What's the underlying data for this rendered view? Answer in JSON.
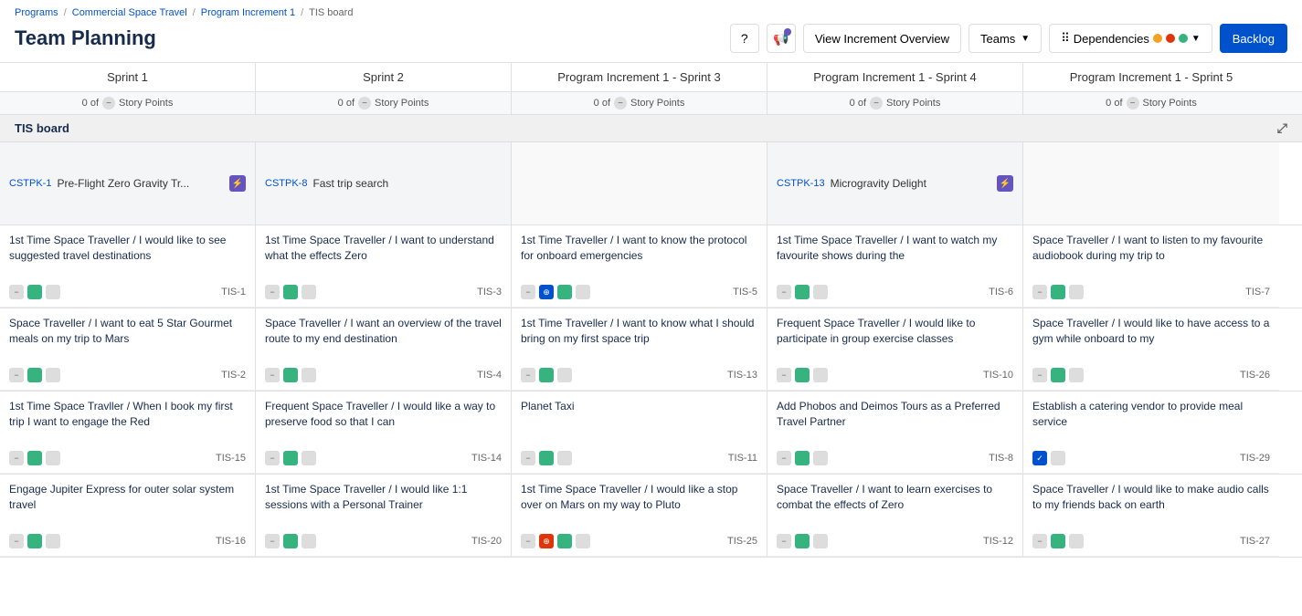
{
  "breadcrumb": {
    "items": [
      "Programs",
      "Commercial Space Travel",
      "Program Increment 1",
      "TIS board"
    ]
  },
  "page": {
    "title": "Team Planning"
  },
  "header": {
    "view_increment_btn": "View Increment Overview",
    "teams_btn": "Teams",
    "dependencies_btn": "Dependencies",
    "backlog_btn": "Backlog"
  },
  "sprints": [
    {
      "label": "Sprint 1"
    },
    {
      "label": "Sprint 2"
    },
    {
      "label": "Program Increment 1 - Sprint 3"
    },
    {
      "label": "Program Increment 1 - Sprint 4"
    },
    {
      "label": "Program Increment 1 - Sprint 5"
    }
  ],
  "points": [
    {
      "count": "0 of",
      "label": "Story Points"
    },
    {
      "count": "0 of",
      "label": "Story Points"
    },
    {
      "count": "0 of",
      "label": "Story Points"
    },
    {
      "count": "0 of",
      "label": "Story Points"
    },
    {
      "count": "0 of",
      "label": "Story Points"
    }
  ],
  "section": {
    "title": "TIS board"
  },
  "epics": [
    {
      "tag": "CSTPK-1",
      "title": "Pre-Flight Zero Gravity Tr...",
      "hasIcon": true
    },
    {
      "tag": "CSTPK-8",
      "title": "Fast trip search",
      "hasIcon": false
    },
    {
      "tag": "",
      "title": "",
      "hasIcon": false
    },
    {
      "tag": "CSTPK-13",
      "title": "Microgravity Delight",
      "hasIcon": true
    },
    {
      "tag": "",
      "title": "",
      "hasIcon": false
    }
  ],
  "story_rows": [
    [
      {
        "text": "1st Time Space Traveller / I would like to see suggested travel  destinations",
        "id": "TIS-1",
        "icons": [
          "minus",
          "green",
          "grey"
        ]
      },
      {
        "text": "1st Time Space Traveller / I want to understand what the effects Zero",
        "id": "TIS-3",
        "icons": [
          "minus",
          "green",
          "grey"
        ]
      },
      {
        "text": "1st Time Traveller / I want to know the protocol for onboard emergencies",
        "id": "TIS-5",
        "icons": [
          "minus",
          "network",
          "green",
          "grey"
        ]
      },
      {
        "text": "1st Time Space Traveller / I want to watch my favourite shows during the",
        "id": "TIS-6",
        "icons": [
          "minus",
          "green",
          "grey"
        ]
      },
      {
        "text": "Space Traveller / I want to listen to my favourite audiobook during my trip to",
        "id": "TIS-7",
        "icons": [
          "minus",
          "green",
          "grey"
        ]
      }
    ],
    [
      {
        "text": "Space Traveller / I want to eat 5 Star Gourmet meals on my trip to Mars",
        "id": "TIS-2",
        "icons": [
          "minus",
          "green",
          "grey"
        ]
      },
      {
        "text": "Space Traveller / I want an overview of the travel route to my end destination",
        "id": "TIS-4",
        "icons": [
          "minus",
          "green",
          "grey"
        ]
      },
      {
        "text": "1st Time Traveller / I want to know what I should bring on my first space trip",
        "id": "TIS-13",
        "icons": [
          "minus",
          "green",
          "grey"
        ]
      },
      {
        "text": "Frequent Space Traveller / I would like to participate in group exercise classes",
        "id": "TIS-10",
        "icons": [
          "minus",
          "green",
          "grey"
        ]
      },
      {
        "text": "Space Traveller / I would like to have access to a gym while onboard to my",
        "id": "TIS-26",
        "icons": [
          "minus",
          "green",
          "grey"
        ]
      }
    ],
    [
      {
        "text": "1st Time Space Travller / When I book my first trip I want to engage the Red",
        "id": "TIS-15",
        "icons": [
          "minus",
          "green",
          "grey"
        ]
      },
      {
        "text": "Frequent Space Traveller / I would like a way to preserve food so that I can",
        "id": "TIS-14",
        "icons": [
          "minus",
          "green",
          "grey"
        ]
      },
      {
        "text": "Planet Taxi",
        "id": "TIS-11",
        "icons": [
          "minus",
          "green",
          "grey"
        ]
      },
      {
        "text": "Add Phobos and Deimos Tours as a Preferred Travel Partner",
        "id": "TIS-8",
        "icons": [
          "minus",
          "green",
          "grey"
        ]
      },
      {
        "text": "Establish a catering vendor to provide meal service",
        "id": "TIS-29",
        "icons": [
          "check",
          "grey"
        ]
      }
    ],
    [
      {
        "text": "Engage Jupiter Express for outer solar system travel",
        "id": "TIS-16",
        "icons": [
          "minus",
          "green",
          "grey"
        ]
      },
      {
        "text": "1st Time Space Traveller / I would like 1:1 sessions with a Personal Trainer",
        "id": "TIS-20",
        "icons": [
          "minus",
          "green",
          "grey"
        ]
      },
      {
        "text": "1st Time Space Traveller / I would like a stop over on Mars on my way to Pluto",
        "id": "TIS-25",
        "icons": [
          "minus",
          "network",
          "green",
          "grey"
        ]
      },
      {
        "text": "Space Traveller / I want to learn exercises to combat the effects of Zero",
        "id": "TIS-12",
        "icons": [
          "minus",
          "green",
          "grey"
        ]
      },
      {
        "text": "Space Traveller / I would like to make audio calls to my friends back on earth",
        "id": "TIS-27",
        "icons": [
          "minus",
          "green",
          "grey"
        ]
      }
    ]
  ],
  "colors": {
    "accent_blue": "#0052cc",
    "purple": "#6554c0",
    "green": "#36b37e",
    "orange": "#ff8b00",
    "red": "#de350b",
    "dep1": "#f4a024",
    "dep2": "#de350b",
    "dep3": "#36b37e"
  }
}
